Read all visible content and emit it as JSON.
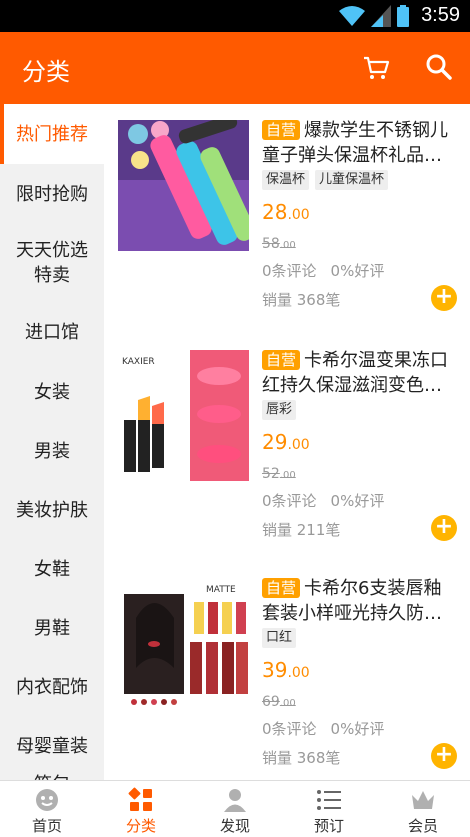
{
  "status_bar": {
    "time": "3:59"
  },
  "header": {
    "title": "分类"
  },
  "sidebar": {
    "items": [
      {
        "label": "热门推荐",
        "active": true
      },
      {
        "label": "限时抢购"
      },
      {
        "label": "天天优选特卖"
      },
      {
        "label": "进口馆"
      },
      {
        "label": "女装"
      },
      {
        "label": "男装"
      },
      {
        "label": "美妆护肤"
      },
      {
        "label": "女鞋"
      },
      {
        "label": "男鞋"
      },
      {
        "label": "内衣配饰"
      },
      {
        "label": "母婴童装"
      },
      {
        "label": "箱包"
      }
    ]
  },
  "products": [
    {
      "self_tag": "自营",
      "title": "爆款学生不锈钢儿童子弹头保温杯礼品…",
      "tags": [
        "保温杯",
        "儿童保温杯"
      ],
      "price_int": "28",
      "price_dec": ".00",
      "orig_int": "58",
      "orig_dec": ".00",
      "reviews": "0条评论",
      "good_rate": "0%好评",
      "sales": "销量 368笔"
    },
    {
      "self_tag": "自营",
      "title": "卡希尔温变果冻口红持久保湿滋润变色…",
      "tags": [
        "唇彩"
      ],
      "price_int": "29",
      "price_dec": ".00",
      "orig_int": "52",
      "orig_dec": ".00",
      "reviews": "0条评论",
      "good_rate": "0%好评",
      "sales": "销量 211笔",
      "image_brand": "KAXIER"
    },
    {
      "self_tag": "自营",
      "title": "卡希尔6支装唇釉套装小样哑光持久防…",
      "tags": [
        "口红"
      ],
      "price_int": "39",
      "price_dec": ".00",
      "orig_int": "69",
      "orig_dec": ".00",
      "reviews": "0条评论",
      "good_rate": "0%好评",
      "sales": "销量 368笔",
      "image_brand": "MATTE"
    }
  ],
  "tab_bar": {
    "tabs": [
      {
        "label": "首页",
        "icon": "home-icon"
      },
      {
        "label": "分类",
        "icon": "category-icon",
        "active": true
      },
      {
        "label": "发现",
        "icon": "discover-icon"
      },
      {
        "label": "预订",
        "icon": "booking-icon"
      },
      {
        "label": "会员",
        "icon": "member-icon"
      }
    ]
  },
  "colors": {
    "accent": "#ff5a00",
    "price": "#ff8c00",
    "self_tag": "#ffa000",
    "add_button": "#ffb400"
  }
}
